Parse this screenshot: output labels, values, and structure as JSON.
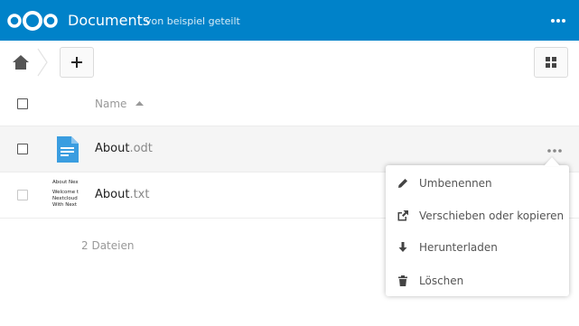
{
  "header": {
    "title": "Documents",
    "subtitle": "von beispiel geteilt",
    "accent_color": "#0082c9",
    "logo_icon": "nextcloud-logo-icon",
    "menu_icon": "more-horizontal-icon"
  },
  "controls": {
    "home_icon": "home-icon",
    "add_icon": "plus-icon",
    "view_toggle_icon": "grid-view-icon"
  },
  "table": {
    "name_header": "Name",
    "sort_icon": "sort-ascending-icon",
    "rows": [
      {
        "name": "About",
        "ext": ".odt",
        "icon": "document-icon"
      },
      {
        "name": "About",
        "ext": ".txt",
        "thumbnail_text": [
          "About Nex",
          "Welcome t",
          "Nextcloud",
          "With Next"
        ]
      }
    ],
    "summary": "2 Dateien"
  },
  "context_menu": {
    "items": [
      {
        "label": "Umbenennen",
        "icon": "pencil-icon"
      },
      {
        "label": "Verschieben oder kopieren",
        "icon": "external-link-icon"
      },
      {
        "label": "Herunterladen",
        "icon": "download-icon"
      },
      {
        "label": "Löschen",
        "icon": "trash-icon"
      }
    ]
  }
}
